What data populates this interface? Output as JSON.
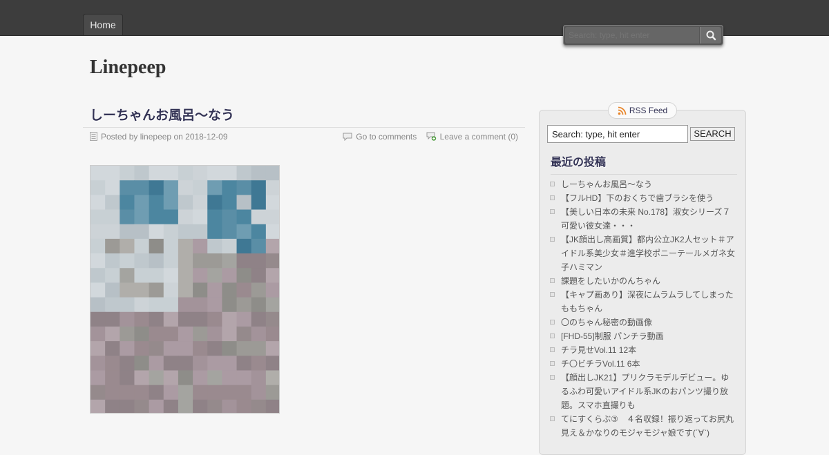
{
  "nav": {
    "home_label": "Home"
  },
  "header_search": {
    "placeholder": "Search: type, hit enter"
  },
  "site": {
    "title": "Linepeep"
  },
  "post": {
    "title": "しーちゃんお風呂～なう",
    "posted_by_prefix": "Posted by",
    "author": "linepeep",
    "on_word": "on",
    "date": "2018-12-09",
    "go_to_comments": "Go to comments",
    "leave_comment": "Leave a comment (0)"
  },
  "sidebar": {
    "rss_label": "RSS Feed",
    "search_value": "Search: type, hit enter",
    "search_button": "SEARCH",
    "recent_title": "最近の投稿",
    "recent_posts": [
      "しーちゃんお風呂～なう",
      "【フルHD】下のおくちで歯ブラシを使う",
      "【美しい日本の未来 No.178】淑女シリーズ７　可愛い彼女達・・・",
      "【JK顔出し高画質】都内公立JK2人セット＃アイドル系美少女＃進学校ポニーテールメガネ女子ハミマン",
      "課題をしたいかのんちゃん",
      "【キャプ画あり】深夜にムラムラしてしまったももちゃん",
      "〇のちゃん秘密の動画像",
      "[FHD-55]制服 パンチラ動画",
      "チラ見せVol.11 12本",
      "チ〇ビチラVol.11 6本",
      "【顔出しJK21】プリクラモデルデビュー。ゆるふわ可愛いアイドル系JKのおパンツ撮り放題。スマホ直撮りも",
      "てにすくらぶ③　４名収録！振り返ってお尻丸見え＆かなりのモジャモジャ娘です(´∀`)"
    ]
  },
  "colors": {
    "topbar": "#3d3d3d",
    "page_bg": "#f6f6f6",
    "title_blue": "#335"
  }
}
